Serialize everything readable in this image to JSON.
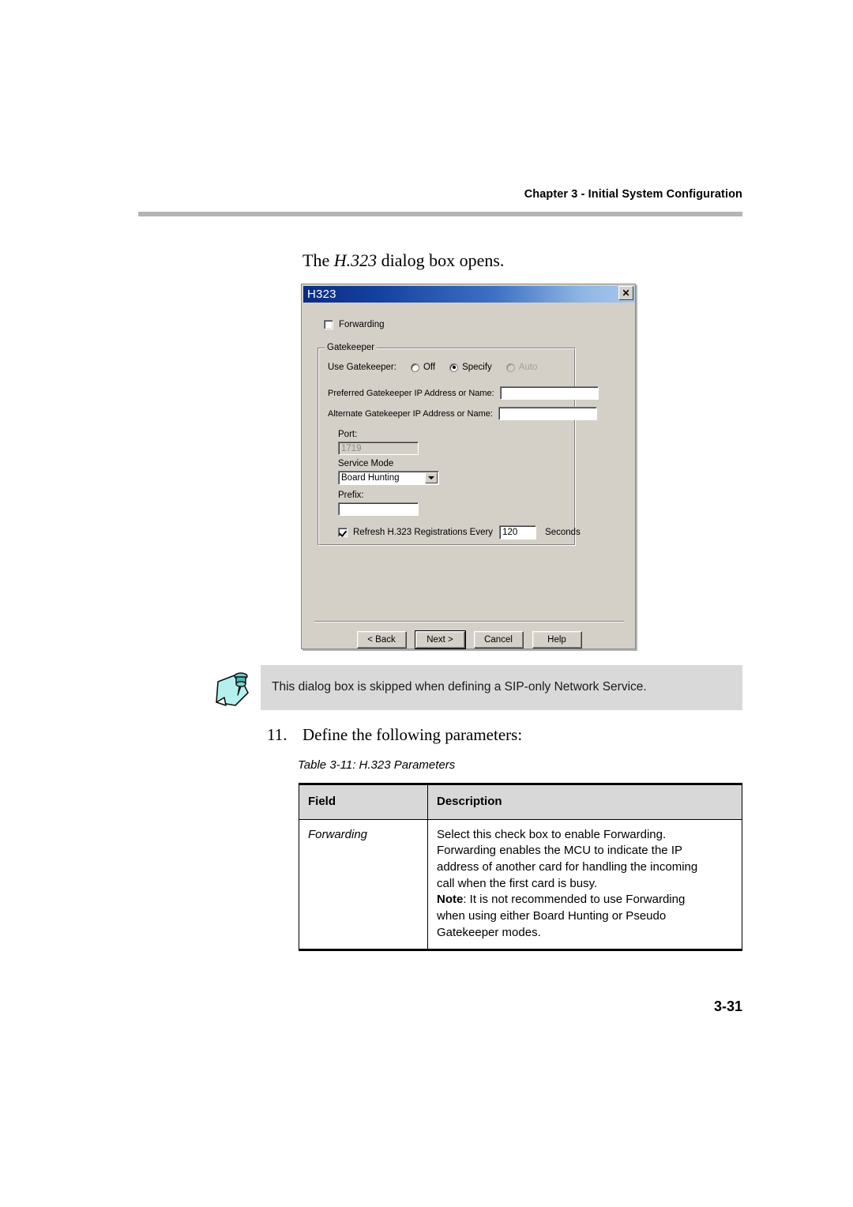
{
  "page": {
    "header": "Chapter 3 - Initial System Configuration",
    "number": "3-31",
    "intro_before": "The ",
    "intro_italic": "H.323",
    "intro_after": " dialog box opens."
  },
  "dialog": {
    "title": "H323",
    "close_label": "✕",
    "forwarding_checkbox": {
      "label": "Forwarding",
      "checked": false
    },
    "gatekeeper_group": {
      "title": "Gatekeeper",
      "use_gatekeeper_label": "Use Gatekeeper:",
      "radios": [
        {
          "label": "Off",
          "selected": false,
          "disabled": false
        },
        {
          "label": "Specify",
          "selected": true,
          "disabled": false
        },
        {
          "label": "Auto",
          "selected": false,
          "disabled": true
        }
      ],
      "preferred_label": "Preferred Gatekeeper IP Address or Name:",
      "preferred_value": "",
      "alternate_label": "Alternate Gatekeeper IP Address or Name:",
      "alternate_value": "",
      "port_label": "Port:",
      "port_value": "1719",
      "service_mode_label": "Service Mode",
      "service_mode_value": "Board Hunting",
      "prefix_label": "Prefix:",
      "prefix_value": "",
      "refresh_checkbox_label": "Refresh H.323 Registrations Every",
      "refresh_checked": true,
      "refresh_value": "120",
      "refresh_units": "Seconds"
    },
    "buttons": [
      {
        "label": "< Back",
        "default": false
      },
      {
        "label": "Next >",
        "default": true
      },
      {
        "label": "Cancel",
        "default": false
      },
      {
        "label": "Help",
        "default": false
      }
    ]
  },
  "note": {
    "icon": "note-pushpin-icon",
    "text": "This dialog box is skipped when defining a SIP-only Network Service."
  },
  "step": {
    "number": "11.",
    "text": "Define the following parameters:"
  },
  "table": {
    "caption": "Table 3-11: H.323 Parameters",
    "headers": [
      "Field",
      "Description"
    ],
    "rows": [
      {
        "field": "Forwarding",
        "description_lines": [
          "Select this check box to enable Forwarding.",
          "Forwarding enables the MCU to indicate the IP",
          "address of another card for handling the incoming",
          "call when the first card is busy."
        ],
        "note_label": "Note",
        "note_lines": [
          ": It is not recommended to use Forwarding",
          "when using either Board Hunting or Pseudo",
          "Gatekeeper modes."
        ]
      }
    ]
  },
  "colors": {
    "dialog_face": "#d4d0c8",
    "title_dark": "#0b2d82",
    "title_light": "#a8c8ec",
    "note_bg": "#d9d9d9",
    "table_header_bg": "#d8d8d8",
    "rule": "#b5b5b5"
  }
}
